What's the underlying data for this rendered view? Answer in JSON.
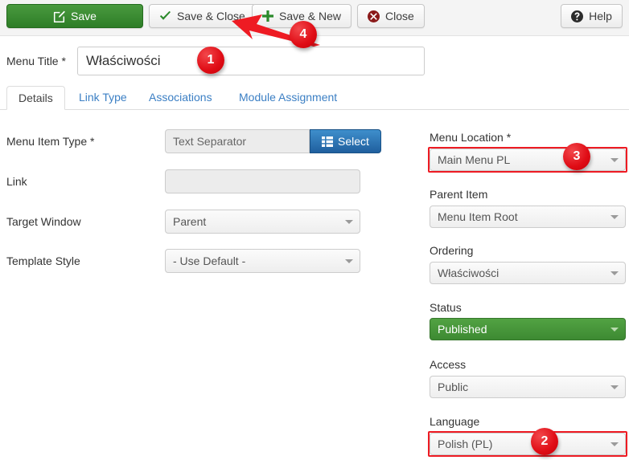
{
  "toolbar": {
    "save": "Save",
    "save_close": "Save & Close",
    "save_new": "Save & New",
    "close": "Close",
    "help": "Help",
    "icons": {
      "save": "edit-pencil-icon",
      "save_close": "checkmark-icon",
      "save_new": "plus-icon",
      "close": "close-circle-icon",
      "help": "help-circle-icon"
    },
    "colors": {
      "save_green": "#2e7d27",
      "bar_background": "#f4f4f4",
      "close_red": "#8b1a1a"
    }
  },
  "menu_title": {
    "label": "Menu Title *",
    "value": "Właściwości",
    "placeholder": ""
  },
  "tabs": [
    {
      "label": "Details",
      "active": true
    },
    {
      "label": "Link Type",
      "active": false
    },
    {
      "label": "Associations",
      "active": false
    },
    {
      "label": "Module Assignment",
      "active": false
    }
  ],
  "left_fields": [
    {
      "label": "Menu Item Type *",
      "value": "Text Separator",
      "type": "readonly-with-button",
      "button_label": "Select",
      "button_icon": "grid-icon"
    },
    {
      "label": "Link",
      "value": "",
      "type": "readonly"
    },
    {
      "label": "Target Window",
      "value": "Parent",
      "type": "select"
    },
    {
      "label": "Template Style",
      "value": "- Use Default -",
      "type": "select"
    }
  ],
  "right_fields": [
    {
      "label": "Menu Location *",
      "value": "Main Menu PL",
      "type": "select",
      "highlighted": true
    },
    {
      "label": "Parent Item",
      "value": "Menu Item Root",
      "type": "select",
      "highlighted": false
    },
    {
      "label": "Ordering",
      "value": "Właściwości",
      "type": "select",
      "highlighted": false
    },
    {
      "label": "Status",
      "value": "Published",
      "type": "select-published",
      "highlighted": false
    },
    {
      "label": "Access",
      "value": "Public",
      "type": "select",
      "highlighted": false
    },
    {
      "label": "Language",
      "value": "Polish (PL)",
      "type": "select",
      "highlighted": true
    }
  ],
  "callouts": [
    {
      "number": "1",
      "target": "menu-title-input"
    },
    {
      "number": "2",
      "target": "language-select"
    },
    {
      "number": "3",
      "target": "menu-location-select"
    },
    {
      "number": "4",
      "target": "save-close-button"
    }
  ],
  "annotation_color": "#ee1b23"
}
